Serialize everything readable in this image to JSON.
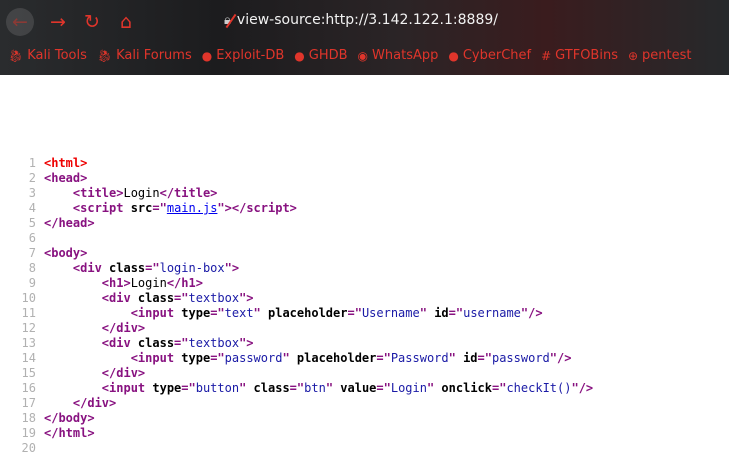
{
  "browser": {
    "url": "view-source:http://3.142.122.1:8889/",
    "bookmarks": [
      {
        "label": "Kali Tools",
        "icon": "kali-dragon-icon"
      },
      {
        "label": "Kali Forums",
        "icon": "kali-dragon-icon"
      },
      {
        "label": "Exploit-DB",
        "icon": "exploitdb-icon"
      },
      {
        "label": "GHDB",
        "icon": "exploitdb-icon"
      },
      {
        "label": "WhatsApp",
        "icon": "whatsapp-icon"
      },
      {
        "label": "CyberChef",
        "icon": "chef-hat-icon"
      },
      {
        "label": "GTFOBins",
        "icon": "hash-icon"
      },
      {
        "label": "pentest",
        "icon": "globe-icon"
      }
    ]
  },
  "source": {
    "lines": [
      [
        [
          "err",
          "<html>"
        ]
      ],
      [
        [
          "tag",
          "<head>"
        ]
      ],
      [
        [
          "txt",
          "    "
        ],
        [
          "tag",
          "<title>"
        ],
        [
          "txt",
          "Login"
        ],
        [
          "tag",
          "</title>"
        ]
      ],
      [
        [
          "txt",
          "    "
        ],
        [
          "tag",
          "<script "
        ],
        [
          "attr",
          "src"
        ],
        [
          "tag",
          "=\""
        ],
        [
          "link",
          "main.js"
        ],
        [
          "tag",
          "\"></script>"
        ]
      ],
      [
        [
          "tag",
          "</head>"
        ]
      ],
      [],
      [
        [
          "tag",
          "<body>"
        ]
      ],
      [
        [
          "txt",
          "    "
        ],
        [
          "tag",
          "<div "
        ],
        [
          "attr",
          "class"
        ],
        [
          "tag",
          "=\""
        ],
        [
          "val",
          "login-box"
        ],
        [
          "tag",
          "\">"
        ]
      ],
      [
        [
          "txt",
          "        "
        ],
        [
          "tag",
          "<h1>"
        ],
        [
          "txt",
          "Login"
        ],
        [
          "tag",
          "</h1>"
        ]
      ],
      [
        [
          "txt",
          "        "
        ],
        [
          "tag",
          "<div "
        ],
        [
          "attr",
          "class"
        ],
        [
          "tag",
          "=\""
        ],
        [
          "val",
          "textbox"
        ],
        [
          "tag",
          "\">"
        ]
      ],
      [
        [
          "txt",
          "            "
        ],
        [
          "tag",
          "<input "
        ],
        [
          "attr",
          "type"
        ],
        [
          "tag",
          "=\""
        ],
        [
          "val",
          "text"
        ],
        [
          "tag",
          "\" "
        ],
        [
          "attr",
          "placeholder"
        ],
        [
          "tag",
          "=\""
        ],
        [
          "val",
          "Username"
        ],
        [
          "tag",
          "\" "
        ],
        [
          "attr",
          "id"
        ],
        [
          "tag",
          "=\""
        ],
        [
          "val",
          "username"
        ],
        [
          "tag",
          "\"/>"
        ]
      ],
      [
        [
          "txt",
          "        "
        ],
        [
          "tag",
          "</div>"
        ]
      ],
      [
        [
          "txt",
          "        "
        ],
        [
          "tag",
          "<div "
        ],
        [
          "attr",
          "class"
        ],
        [
          "tag",
          "=\""
        ],
        [
          "val",
          "textbox"
        ],
        [
          "tag",
          "\">"
        ]
      ],
      [
        [
          "txt",
          "            "
        ],
        [
          "tag",
          "<input "
        ],
        [
          "attr",
          "type"
        ],
        [
          "tag",
          "=\""
        ],
        [
          "val",
          "password"
        ],
        [
          "tag",
          "\" "
        ],
        [
          "attr",
          "placeholder"
        ],
        [
          "tag",
          "=\""
        ],
        [
          "val",
          "Password"
        ],
        [
          "tag",
          "\" "
        ],
        [
          "attr",
          "id"
        ],
        [
          "tag",
          "=\""
        ],
        [
          "val",
          "password"
        ],
        [
          "tag",
          "\"/>"
        ]
      ],
      [
        [
          "txt",
          "        "
        ],
        [
          "tag",
          "</div>"
        ]
      ],
      [
        [
          "txt",
          "        "
        ],
        [
          "tag",
          "<input "
        ],
        [
          "attr",
          "type"
        ],
        [
          "tag",
          "=\""
        ],
        [
          "val",
          "button"
        ],
        [
          "tag",
          "\" "
        ],
        [
          "attr",
          "class"
        ],
        [
          "tag",
          "=\""
        ],
        [
          "val",
          "btn"
        ],
        [
          "tag",
          "\" "
        ],
        [
          "attr",
          "value"
        ],
        [
          "tag",
          "=\""
        ],
        [
          "val",
          "Login"
        ],
        [
          "tag",
          "\" "
        ],
        [
          "attr",
          "onclick"
        ],
        [
          "tag",
          "=\""
        ],
        [
          "val",
          "checkIt()"
        ],
        [
          "tag",
          "\"/>"
        ]
      ],
      [
        [
          "txt",
          "    "
        ],
        [
          "tag",
          "</div>"
        ]
      ],
      [
        [
          "tag",
          "</body>"
        ]
      ],
      [
        [
          "tag",
          "</html>"
        ]
      ],
      []
    ]
  }
}
